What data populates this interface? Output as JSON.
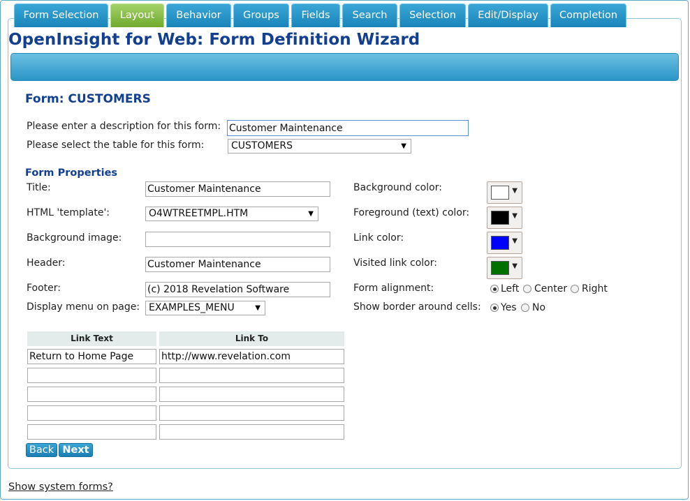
{
  "app": {
    "title": "OpenInsight for Web: Form Definition Wizard"
  },
  "tabs": [
    {
      "label": "Form Selection"
    },
    {
      "label": "Layout",
      "active": true
    },
    {
      "label": "Behavior"
    },
    {
      "label": "Groups"
    },
    {
      "label": "Fields"
    },
    {
      "label": "Search"
    },
    {
      "label": "Selection"
    },
    {
      "label": "Edit/Display"
    },
    {
      "label": "Completion"
    }
  ],
  "form": {
    "title": "Form: CUSTOMERS",
    "description_label": "Please enter a description for this form:",
    "description_value": "Customer Maintenance",
    "table_label": "Please select the table for this form:",
    "table_value": "CUSTOMERS"
  },
  "properties": {
    "heading": "Form Properties",
    "title_label": "Title:",
    "title_value": "Customer Maintenance",
    "template_label": "HTML 'template':",
    "template_value": "O4WTREETMPL.HTM",
    "bgimage_label": "Background image:",
    "bgimage_value": "",
    "header_label": "Header:",
    "header_value": "Customer Maintenance",
    "footer_label": "Footer:",
    "footer_value": "(c) 2018 Revelation Software",
    "menu_label": "Display menu on page:",
    "menu_value": "EXAMPLES_MENU",
    "bgcolor_label": "Background color:",
    "bgcolor_value": "#ffffff",
    "fgcolor_label": "Foreground (text) color:",
    "fgcolor_value": "#000000",
    "linkcolor_label": "Link color:",
    "linkcolor_value": "#0000ff",
    "vlinkcolor_label": "Visited link color:",
    "vlinkcolor_value": "#007000",
    "alignment_label": "Form alignment:",
    "alignment_options": [
      "Left",
      "Center",
      "Right"
    ],
    "alignment_selected": "Left",
    "border_label": "Show border around cells:",
    "border_options": [
      "Yes",
      "No"
    ],
    "border_selected": "Yes"
  },
  "links": {
    "headers": [
      "Link Text",
      "Link To"
    ],
    "rows": [
      [
        "Return to Home Page",
        "http://www.revelation.com"
      ],
      [
        "",
        ""
      ],
      [
        "",
        ""
      ],
      [
        "",
        ""
      ],
      [
        "",
        ""
      ]
    ]
  },
  "nav": {
    "back": "Back",
    "next": "Next"
  },
  "footer_link": "Show system forms?"
}
